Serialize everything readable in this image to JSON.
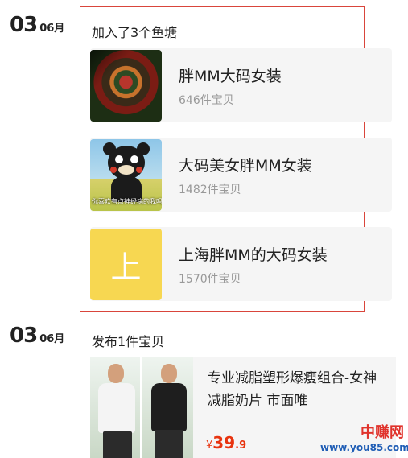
{
  "feed": [
    {
      "day": "03",
      "month": "06月",
      "action": "加入了3个鱼塘",
      "ponds": [
        {
          "name": "胖MM大码女装",
          "count": "646件宝贝"
        },
        {
          "name": "大码美女胖MM女装",
          "count": "1482件宝贝",
          "thumb_caption": "你喜欢有点神经病的我吗"
        },
        {
          "name": "上海胖MM的大码女装",
          "count": "1570件宝贝",
          "thumb_char": "上"
        }
      ]
    },
    {
      "day": "03",
      "month": "06月",
      "action": "发布1件宝贝",
      "item": {
        "title": "专业减脂塑形爆瘦组合-女神减脂奶片 市面唯",
        "price_symbol": "¥",
        "price_int": "39",
        "price_dec": ".9"
      }
    }
  ],
  "watermark": {
    "name": "中赚网",
    "url": "www.you85.com"
  },
  "colors": {
    "highlight_border": "#d9453b",
    "price": "#e8340f",
    "watermark_red": "#e0322b",
    "watermark_blue": "#1f5db5"
  }
}
